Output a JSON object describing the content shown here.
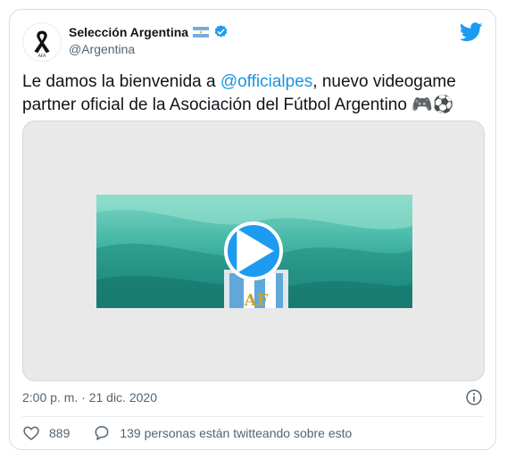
{
  "author": {
    "display_name": "Selección Argentina",
    "handle": "@Argentina"
  },
  "tweet": {
    "text_before": "Le damos la bienvenida a ",
    "mention": "@officialpes",
    "text_after": ", nuevo videogame partner oficial de la Asociación del Fútbol Argentino 🎮⚽"
  },
  "meta": {
    "timestamp": "2:00 p. m. · 21 dic. 2020"
  },
  "actions": {
    "like_count": "889",
    "reply_text": "139 personas están twitteando sobre esto"
  },
  "colors": {
    "accent": "#1d9bf0",
    "mention": "#1b95e0",
    "text_primary": "#0f1419",
    "text_secondary": "#536471"
  },
  "icons": {
    "avatar": "black-ribbon-icon",
    "flag": "argentina-flag-icon",
    "verified": "verified-badge-icon",
    "brand": "twitter-bird-icon",
    "play": "play-icon",
    "info": "info-icon",
    "like": "heart-icon",
    "reply": "comment-icon"
  }
}
